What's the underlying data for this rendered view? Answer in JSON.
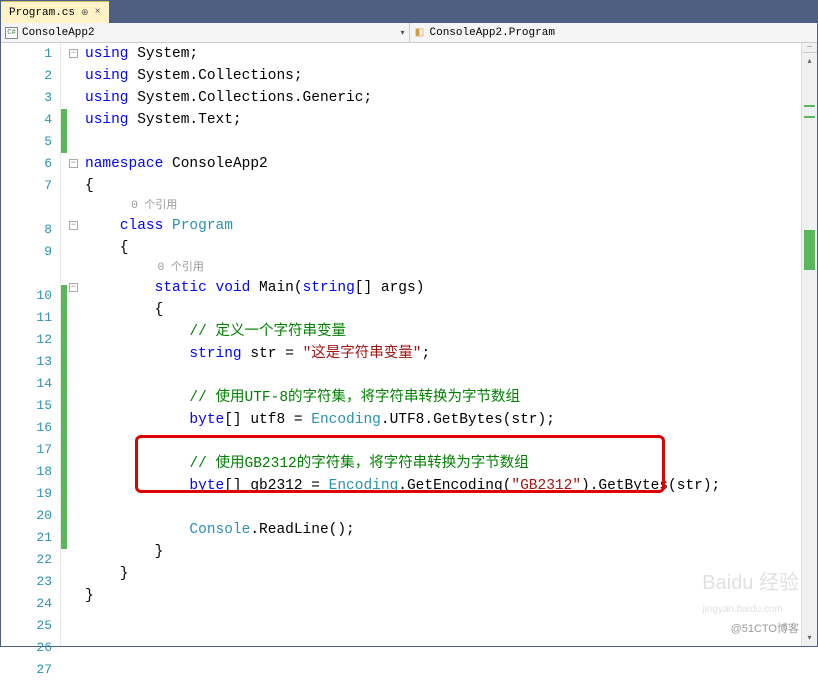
{
  "tab": {
    "filename": "Program.cs"
  },
  "nav": {
    "left": "ConsoleApp2",
    "right": "ConsoleApp2.Program"
  },
  "refs": "0 个引用",
  "code": {
    "l1": {
      "kw": "using",
      "rest": " System;"
    },
    "l2": {
      "kw": "using",
      "rest": " System.Collections;"
    },
    "l3": {
      "kw": "using",
      "rest": " System.Collections.Generic;"
    },
    "l4": {
      "kw": "using",
      "rest": " System.Text;"
    },
    "l6": {
      "kw": "namespace",
      "rest": " ConsoleApp2"
    },
    "l7": "{",
    "l8": {
      "kw": "class",
      "name": " Program"
    },
    "l9": "    {",
    "l10": {
      "pre": "        ",
      "kw1": "static",
      "kw2": " void",
      "name": " Main(",
      "kw3": "string",
      "rest": "[] args)"
    },
    "l11": "        {",
    "l12": {
      "pre": "            ",
      "c": "// 定义一个字符串变量"
    },
    "l13": {
      "pre": "            ",
      "kw": "string",
      "mid": " str = ",
      "str": "\"这是字符串变量\"",
      "end": ";"
    },
    "l15": {
      "pre": "            ",
      "c": "// 使用UTF-8的字符集，将字符串转换为字节数组"
    },
    "l16": {
      "pre": "            ",
      "kw": "byte",
      "mid": "[] utf8 = ",
      "type": "Encoding",
      "end": ".UTF8.GetBytes(str);"
    },
    "l18": {
      "pre": "            ",
      "c": "// 使用GB2312的字符集，将字符串转换为字节数组"
    },
    "l19": {
      "pre": "            ",
      "kw": "byte",
      "mid": "[] gb2312 = ",
      "type": "Encoding",
      "m2": ".GetEncoding(",
      "str": "\"GB2312\"",
      "end": ").GetBytes(str);"
    },
    "l21": {
      "pre": "            ",
      "type": "Console",
      "end": ".ReadLine();"
    },
    "l22": "        }",
    "l23": "    }",
    "l24": "}"
  },
  "watermark": {
    "top": "Baidu 经验",
    "url": "jingyan.baidu.com",
    "bottom": "@51CTO博客"
  }
}
